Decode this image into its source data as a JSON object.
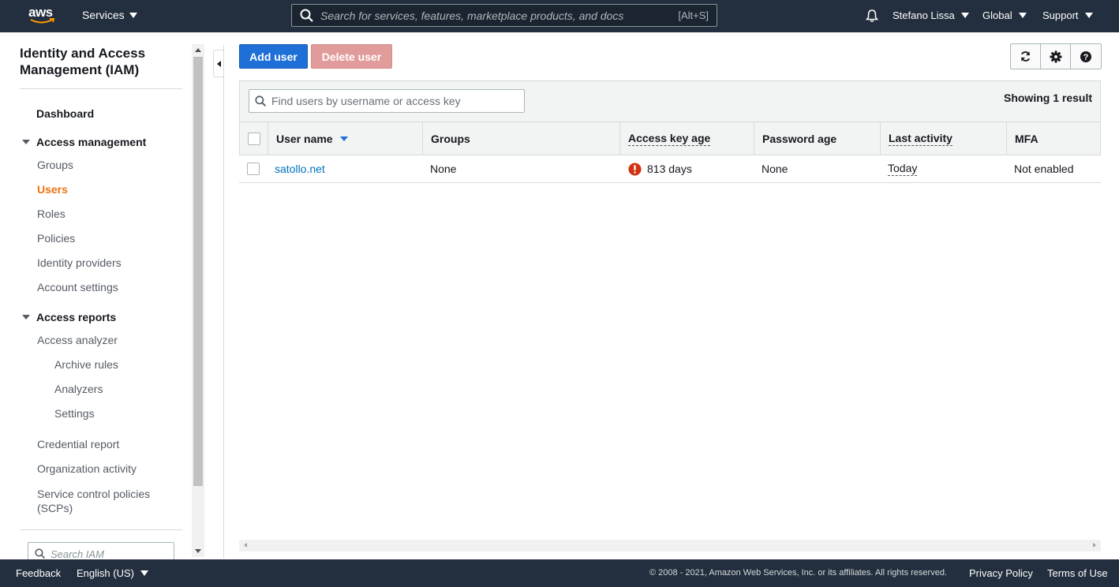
{
  "topnav": {
    "logo": "aws",
    "services_label": "Services",
    "search_placeholder": "Search for services, features, marketplace products, and docs",
    "search_shortcut": "[Alt+S]",
    "user": "Stefano Lissa",
    "region": "Global",
    "support": "Support"
  },
  "sidebar": {
    "title": "Identity and Access Management (IAM)",
    "dashboard": "Dashboard",
    "access_management": {
      "label": "Access management",
      "items": [
        "Groups",
        "Users",
        "Roles",
        "Policies",
        "Identity providers",
        "Account settings"
      ]
    },
    "active_item": "Users",
    "access_reports": {
      "label": "Access reports",
      "analyzer": "Access analyzer",
      "sub_items": [
        "Archive rules",
        "Analyzers",
        "Settings"
      ],
      "items": [
        "Credential report",
        "Organization activity",
        "Service control policies (SCPs)"
      ]
    },
    "search_placeholder": "Search IAM"
  },
  "toolbar": {
    "add_user": "Add user",
    "delete_user": "Delete user"
  },
  "table": {
    "search_placeholder": "Find users by username or access key",
    "result_count": "Showing 1 result",
    "columns": [
      "User name",
      "Groups",
      "Access key age",
      "Password age",
      "Last activity",
      "MFA"
    ],
    "rows": [
      {
        "user_name": "satollo.net",
        "groups": "None",
        "access_key_age": "813 days",
        "password_age": "None",
        "last_activity": "Today",
        "mfa": "Not enabled"
      }
    ]
  },
  "footer": {
    "feedback": "Feedback",
    "language": "English (US)",
    "copyright": "© 2008 - 2021, Amazon Web Services, Inc. or its affiliates. All rights reserved.",
    "privacy": "Privacy Policy",
    "terms": "Terms of Use"
  },
  "colors": {
    "nav_bg": "#232f3e",
    "primary": "#1e6fd8",
    "danger_disabled": "#e19b9b",
    "active_nav": "#ec7211",
    "link": "#0073bb",
    "error": "#d13212"
  },
  "icons": [
    "magnifier-icon",
    "bell-icon",
    "refresh-icon",
    "gear-icon",
    "help-icon",
    "error-icon",
    "sort-desc-icon"
  ]
}
